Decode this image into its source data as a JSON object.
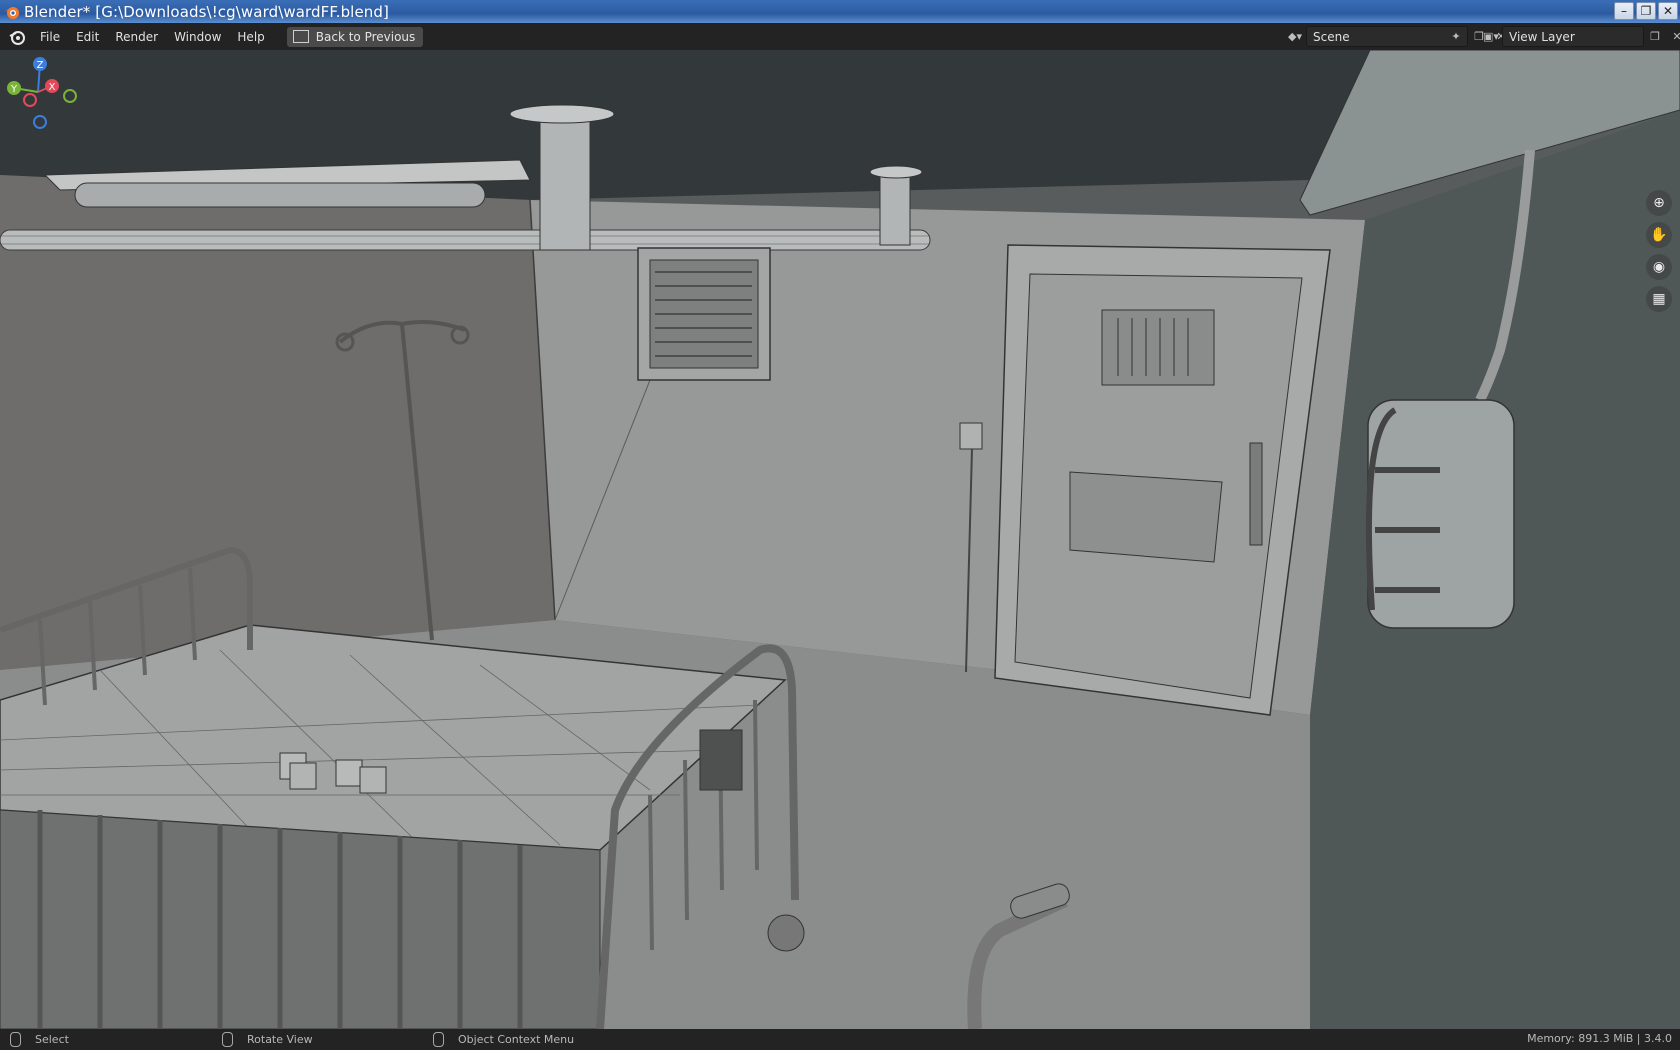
{
  "window": {
    "title": "Blender* [G:\\Downloads\\!cg\\ward\\wardFF.blend]",
    "controls": [
      "minimize",
      "restore",
      "close"
    ]
  },
  "menu": {
    "items": [
      "File",
      "Edit",
      "Render",
      "Window",
      "Help"
    ],
    "back_button": "Back to Previous"
  },
  "header_right": {
    "scene_label": "Scene",
    "view_layer_label": "View Layer"
  },
  "viewport": {
    "gizmo_axes": [
      "Z",
      "Y",
      "X"
    ],
    "nav_tools": [
      "zoom-icon",
      "pan-hand-icon",
      "camera-icon",
      "grid-ortho-icon"
    ]
  },
  "statusbar": {
    "select": "Select",
    "rotate": "Rotate View",
    "context": "Object Context Menu",
    "memory": "Memory: 891.3 MiB | 3.4.0"
  },
  "colors": {
    "title_bar": "#2c5aa0",
    "menu_bg": "#232323",
    "axis_x": "#e04a5a",
    "axis_y": "#7ab33a",
    "axis_z": "#3d7ddb"
  }
}
